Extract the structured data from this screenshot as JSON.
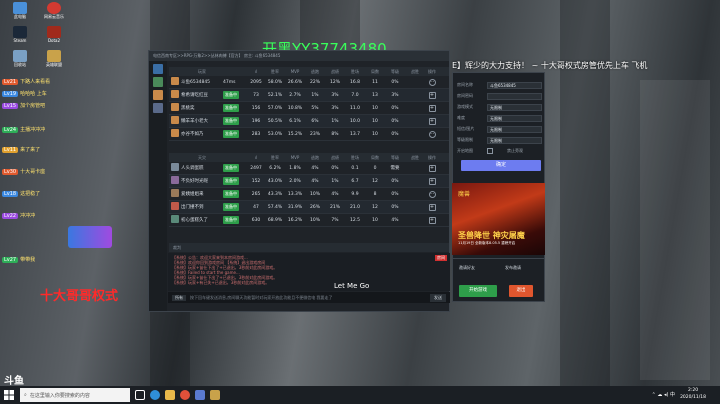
{
  "stream_title": "开黑YY37743480",
  "marquee": "E】辉少的大力支持！ ~ 十大哥权式房管优先上车 飞机",
  "overlay_red": "十大哥哥权式",
  "letme": "Let Me Go",
  "desktop_icons": [
    {
      "label": "此电脑",
      "color": "#4a90d9"
    },
    {
      "label": "网易云音乐",
      "color": "#d33a31"
    },
    {
      "label": "Steam",
      "color": "#1b2838"
    },
    {
      "label": "Dota2",
      "color": "#a02a1c"
    },
    {
      "label": "回收站",
      "color": "#7aa0c4"
    },
    {
      "label": "英雄联盟",
      "color": "#c9a24a"
    }
  ],
  "chat": [
    {
      "tag": "Lv21",
      "tagcolor": "#e05a2e",
      "text": "下路人来看看"
    },
    {
      "tag": "Lv19",
      "tagcolor": "#3a88e0",
      "text": "哈哈哈 上车"
    },
    {
      "tag": "Lv15",
      "tagcolor": "#9a4ae0",
      "text": "加个房管吧"
    },
    {
      "tag": "Lv24",
      "tagcolor": "#2eae58",
      "text": "主播冲冲冲"
    },
    {
      "tag": "Lv11",
      "tagcolor": "#e0a02e",
      "text": "来了来了"
    },
    {
      "tag": "Lv30",
      "tagcolor": "#e05a2e",
      "text": "十大哥卡座"
    },
    {
      "tag": "Lv18",
      "tagcolor": "#3a88e0",
      "text": "这把稳了"
    },
    {
      "tag": "Lv22",
      "tagcolor": "#9a4ae0",
      "text": "冲冲冲"
    },
    {
      "tag": "Lv27",
      "tagcolor": "#2eae58",
      "text": "带带我"
    }
  ],
  "window": {
    "breadcrumb": "电信西南专区>>RPG-万象2>>丛林肉搏【官方】 房主: 斗鱼6534845",
    "headers": [
      "玩家",
      "",
      "胜率",
      "MVP",
      "逃跑",
      "战绩",
      "胜场",
      "局数",
      "等级",
      "战胜",
      "操作"
    ],
    "team1_label": "",
    "team2_label": "天灾",
    "team1": [
      {
        "name": "斗鱼6534845",
        "state": "47ms",
        "c1": "2095",
        "c2": "58.0%",
        "c3": "26.6%",
        "c4": "22%",
        "c5": "12%",
        "c6": "16.8",
        "c7": "11",
        "c8": "0%",
        "op": "⋯"
      },
      {
        "name": "希希请吃红豆",
        "state": "准备中",
        "c1": "73",
        "c2": "52.1%",
        "c3": "2.7%",
        "c4": "1%",
        "c5": "3%",
        "c6": "7.0",
        "c7": "13",
        "c8": "3%",
        "op": "+"
      },
      {
        "name": "黑桃奕",
        "state": "准备中",
        "c1": "156",
        "c2": "57.0%",
        "c3": "10.8%",
        "c4": "5%",
        "c5": "3%",
        "c6": "11.0",
        "c7": "10",
        "c8": "0%",
        "op": "+"
      },
      {
        "name": "懒羊羊小老大",
        "state": "准备中",
        "c1": "196",
        "c2": "50.5%",
        "c3": "6.1%",
        "c4": "6%",
        "c5": "1%",
        "c6": "10.0",
        "c7": "10",
        "c8": "0%",
        "op": "+"
      },
      {
        "name": "亦谷不如乃",
        "state": "准备中",
        "c1": "283",
        "c2": "53.0%",
        "c3": "15.2%",
        "c4": "23%",
        "c5": "8%",
        "c6": "13.7",
        "c7": "10",
        "c8": "0%",
        "op": "⋯"
      }
    ],
    "team2": [
      {
        "name": "人头调蛋糕",
        "state": "准备中",
        "c1": "2497",
        "c2": "6.2%",
        "c3": "1.8%",
        "c4": "4%",
        "c5": "0%",
        "c6": "0.1",
        "c7": "0",
        "c8": "需要",
        "op": "+"
      },
      {
        "name": "不负好时光呢",
        "state": "准备中",
        "c1": "152",
        "c2": "43.0%",
        "c3": "2.0%",
        "c4": "4%",
        "c5": "1%",
        "c6": "6.7",
        "c7": "12",
        "c8": "0%",
        "op": "+"
      },
      {
        "name": "爱姨姐姐来",
        "state": "准备中",
        "c1": "265",
        "c2": "43.3%",
        "c3": "13.3%",
        "c4": "10%",
        "c5": "4%",
        "c6": "9.9",
        "c7": "8",
        "c8": "0%",
        "op": "⋯"
      },
      {
        "name": "出门撞不到",
        "state": "准备中",
        "c1": "47",
        "c2": "57.4%",
        "c3": "31.9%",
        "c4": "26%",
        "c5": "21%",
        "c6": "21.0",
        "c7": "12",
        "c8": "0%",
        "op": "+"
      },
      {
        "name": "初心蛋糕久了",
        "state": "准备中",
        "c1": "630",
        "c2": "68.9%",
        "c3": "16.2%",
        "c4": "10%",
        "c5": "7%",
        "c6": "12.5",
        "c7": "10",
        "c8": "4%",
        "op": "+"
      }
    ],
    "observer_label": "裁判",
    "log": [
      "【系统】公告：欢迎大家来到本房间游戏...",
      "【系统】欢迎你回到游戏房间 【系统】退出游戏房间",
      "【系统】玩家+苗仕下出了+已退出，3秒前对此房间游戏。",
      "【系统】Failed to start the game...",
      "【系统】玩家+苗仕下出了+已退出，3秒前对此房间游戏。",
      "【系统】玩家+有已失+已退出，3秒前对此房间游戏。"
    ],
    "log_badge": "房间",
    "input_scope": "所有",
    "input_placeholder": "按下回车键发送消息,房间聊天功能暂时对玩家开放此功能且不便微信电 我要走了",
    "send_label": "发送"
  },
  "rpanel": {
    "fields": [
      {
        "k": "房间名称",
        "v": "斗鱼6534845"
      },
      {
        "k": "房间密码",
        "v": ""
      },
      {
        "k": "游戏模式",
        "v": "无限制"
      },
      {
        "k": "难度",
        "v": "无限制"
      },
      {
        "k": "短信/图片",
        "v": "无限制"
      },
      {
        "k": "等级限制",
        "v": "无限制"
      },
      {
        "k": "开启地图",
        "v": ""
      }
    ],
    "ok_label": "确定",
    "checkbox_label": "禁止旁观"
  },
  "ad": {
    "top": "魔兽",
    "main": "圣兽降世 神灾屠魔",
    "sub": "11月19日 全新版本8.05.5 重磅开启"
  },
  "ctrl": {
    "btn1": "邀请好友",
    "btn2": "发布邀请",
    "start_label": "开始游戏",
    "quit_label": "退出"
  },
  "taskbar": {
    "search_placeholder": "在这里输入你要搜索的内容",
    "time": "2:20",
    "date": "2020/11/18",
    "tray": "⌃ ☁ ◂) 中"
  },
  "brand": "斗鱼"
}
